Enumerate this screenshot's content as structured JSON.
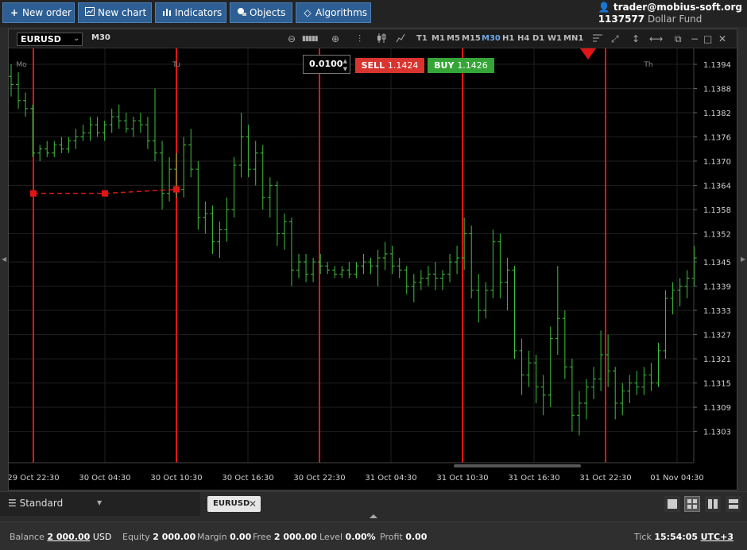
{
  "toolbar": {
    "new_order": "New order",
    "new_chart": "New chart",
    "indicators": "Indicators",
    "objects": "Objects",
    "algorithms": "Algorithms"
  },
  "account": {
    "user": "trader@mobius-soft.org",
    "number": "1137577",
    "fund": "Dollar Fund"
  },
  "chart_header": {
    "symbol": "EURUSD",
    "timeframe": "M30",
    "timeframes": [
      "T1",
      "M1",
      "M5",
      "M15",
      "M30",
      "H1",
      "H4",
      "D1",
      "W1",
      "MN1"
    ],
    "active_timeframe": "M30"
  },
  "order": {
    "quantity": "0.0100",
    "sell_label": "SELL",
    "sell_price": "1.1424",
    "buy_label": "BUY",
    "buy_price": "1.1426"
  },
  "colors": {
    "candle": "#3fbf3f",
    "separator": "#e01515",
    "sell": "#d9342f",
    "buy": "#36a537",
    "accent": "#2d5f94"
  },
  "chart_data": {
    "type": "ohlc",
    "symbol": "EURUSD",
    "timeframe": "M30",
    "day_labels": [
      "Mo",
      "Tu",
      "Th"
    ],
    "x_labels": [
      "29 Oct 22:30",
      "30 Oct 04:30",
      "30 Oct 10:30",
      "30 Oct 16:30",
      "30 Oct 22:30",
      "31 Oct 04:30",
      "31 Oct 10:30",
      "31 Oct 16:30",
      "31 Oct 22:30",
      "01 Nov 04:30"
    ],
    "y_ticks": [
      "1.1394",
      "1.1388",
      "1.1382",
      "1.1376",
      "1.1370",
      "1.1364",
      "1.1358",
      "1.1352",
      "1.1345",
      "1.1339",
      "1.1333",
      "1.1327",
      "1.1321",
      "1.1315",
      "1.1309",
      "1.1303"
    ],
    "ylim": [
      1.1297,
      1.14
    ],
    "separators_at": [
      "29 Oct 22:30",
      "30 Oct 10:30",
      "30 Oct 22:30",
      "31 Oct 10:30",
      "31 Oct 22:30"
    ],
    "trendline": {
      "from": [
        "29 Oct 22:30",
        1.1362
      ],
      "mid": [
        "30 Oct 04:30",
        1.1362
      ],
      "to": [
        "30 Oct 10:30",
        1.1363
      ]
    },
    "series": [
      {
        "values": [
          [
            1.1391,
            1.1394,
            1.1386,
            1.1389
          ],
          [
            1.1389,
            1.1392,
            1.1383,
            1.1385
          ],
          [
            1.1385,
            1.1387,
            1.1381,
            1.1383
          ],
          [
            1.1383,
            1.1384,
            1.1371,
            1.1372
          ],
          [
            1.1372,
            1.1374,
            1.137,
            1.1373
          ],
          [
            1.1373,
            1.1375,
            1.1371,
            1.1372
          ],
          [
            1.1372,
            1.1375,
            1.1371,
            1.1374
          ],
          [
            1.1374,
            1.1376,
            1.1372,
            1.1373
          ],
          [
            1.1373,
            1.1376,
            1.1372,
            1.1375
          ],
          [
            1.1375,
            1.1378,
            1.1373,
            1.1376
          ],
          [
            1.1376,
            1.1379,
            1.1375,
            1.1377
          ],
          [
            1.1377,
            1.1381,
            1.1375,
            1.1379
          ],
          [
            1.1379,
            1.1381,
            1.1376,
            1.1377
          ],
          [
            1.1377,
            1.138,
            1.1375,
            1.1379
          ],
          [
            1.1379,
            1.1383,
            1.1377,
            1.1381
          ],
          [
            1.1381,
            1.1384,
            1.1378,
            1.138
          ],
          [
            1.138,
            1.1382,
            1.1377,
            1.1378
          ],
          [
            1.1378,
            1.1381,
            1.1376,
            1.138
          ],
          [
            1.138,
            1.1382,
            1.1377,
            1.1379
          ],
          [
            1.1379,
            1.1381,
            1.1373,
            1.1375
          ],
          [
            1.1375,
            1.1388,
            1.137,
            1.1372
          ],
          [
            1.1372,
            1.1375,
            1.1358,
            1.1362
          ],
          [
            1.1362,
            1.1371,
            1.136,
            1.1368
          ],
          [
            1.1368,
            1.1372,
            1.1361,
            1.1363
          ],
          [
            1.1363,
            1.1376,
            1.1361,
            1.1374
          ],
          [
            1.1374,
            1.1378,
            1.1366,
            1.1368
          ],
          [
            1.1368,
            1.137,
            1.1353,
            1.1356
          ],
          [
            1.1356,
            1.136,
            1.1352,
            1.1357
          ],
          [
            1.1357,
            1.1359,
            1.1347,
            1.135
          ],
          [
            1.135,
            1.1355,
            1.1346,
            1.1353
          ],
          [
            1.1353,
            1.1361,
            1.135,
            1.1358
          ],
          [
            1.1358,
            1.1371,
            1.1356,
            1.1369
          ],
          [
            1.1369,
            1.1382,
            1.1366,
            1.1376
          ],
          [
            1.1376,
            1.1379,
            1.1366,
            1.1368
          ],
          [
            1.1368,
            1.1375,
            1.1364,
            1.1372
          ],
          [
            1.1372,
            1.1374,
            1.1358,
            1.1361
          ],
          [
            1.1361,
            1.1366,
            1.1356,
            1.1364
          ],
          [
            1.1364,
            1.1365,
            1.1349,
            1.1352
          ],
          [
            1.1352,
            1.1357,
            1.1348,
            1.1355
          ],
          [
            1.1355,
            1.1356,
            1.1339,
            1.1343
          ],
          [
            1.1343,
            1.1347,
            1.1341,
            1.1345
          ],
          [
            1.1345,
            1.1347,
            1.134,
            1.1342
          ],
          [
            1.1342,
            1.1346,
            1.134,
            1.1345
          ],
          [
            1.1345,
            1.1347,
            1.1342,
            1.1344
          ],
          [
            1.1344,
            1.1345,
            1.1342,
            1.1343
          ],
          [
            1.1343,
            1.1344,
            1.1341,
            1.1342
          ],
          [
            1.1342,
            1.1344,
            1.1341,
            1.1343
          ],
          [
            1.1343,
            1.1345,
            1.1341,
            1.1342
          ],
          [
            1.1342,
            1.1345,
            1.1341,
            1.1344
          ],
          [
            1.1344,
            1.1347,
            1.1342,
            1.1345
          ],
          [
            1.1345,
            1.1346,
            1.1342,
            1.1344
          ],
          [
            1.1344,
            1.1348,
            1.1339,
            1.1346
          ],
          [
            1.1346,
            1.135,
            1.1343,
            1.1347
          ],
          [
            1.1347,
            1.1349,
            1.1342,
            1.1344
          ],
          [
            1.1344,
            1.1346,
            1.1341,
            1.1343
          ],
          [
            1.1343,
            1.1344,
            1.1337,
            1.1339
          ],
          [
            1.1339,
            1.1342,
            1.1335,
            1.134
          ],
          [
            1.134,
            1.1343,
            1.1338,
            1.1341
          ],
          [
            1.1341,
            1.1344,
            1.1339,
            1.1342
          ],
          [
            1.1342,
            1.1345,
            1.1338,
            1.1341
          ],
          [
            1.1341,
            1.1343,
            1.1338,
            1.1342
          ],
          [
            1.1342,
            1.1347,
            1.134,
            1.1345
          ],
          [
            1.1345,
            1.1349,
            1.1342,
            1.1346
          ],
          [
            1.1346,
            1.1356,
            1.1343,
            1.1352
          ],
          [
            1.1352,
            1.1354,
            1.1336,
            1.1338
          ],
          [
            1.1338,
            1.1342,
            1.133,
            1.1333
          ],
          [
            1.1333,
            1.134,
            1.1331,
            1.1338
          ],
          [
            1.1338,
            1.1353,
            1.1336,
            1.135
          ],
          [
            1.135,
            1.1352,
            1.1336,
            1.134
          ],
          [
            1.134,
            1.1346,
            1.1333,
            1.1343
          ],
          [
            1.1343,
            1.1344,
            1.1321,
            1.1323
          ],
          [
            1.1323,
            1.1326,
            1.1312,
            1.1317
          ],
          [
            1.1317,
            1.1323,
            1.1314,
            1.132
          ],
          [
            1.132,
            1.1322,
            1.131,
            1.1314
          ],
          [
            1.1314,
            1.1317,
            1.1307,
            1.1312
          ],
          [
            1.1312,
            1.1329,
            1.1309,
            1.1326
          ],
          [
            1.1326,
            1.1344,
            1.1322,
            1.1331
          ],
          [
            1.1331,
            1.1333,
            1.1316,
            1.1319
          ],
          [
            1.1319,
            1.1321,
            1.1303,
            1.1307
          ],
          [
            1.1307,
            1.1313,
            1.1302,
            1.131
          ],
          [
            1.131,
            1.1316,
            1.1306,
            1.1314
          ],
          [
            1.1314,
            1.1319,
            1.1311,
            1.1316
          ],
          [
            1.1316,
            1.1328,
            1.1313,
            1.1322
          ],
          [
            1.1322,
            1.1327,
            1.1314,
            1.1318
          ],
          [
            1.1318,
            1.1319,
            1.1306,
            1.131
          ],
          [
            1.131,
            1.1315,
            1.1307,
            1.1313
          ],
          [
            1.1313,
            1.1317,
            1.131,
            1.1315
          ],
          [
            1.1315,
            1.1318,
            1.1312,
            1.1314
          ],
          [
            1.1314,
            1.1319,
            1.1312,
            1.1317
          ],
          [
            1.1317,
            1.132,
            1.1313,
            1.1315
          ],
          [
            1.1315,
            1.1325,
            1.1314,
            1.1323
          ],
          [
            1.1323,
            1.1338,
            1.1321,
            1.1336
          ],
          [
            1.1336,
            1.134,
            1.1332,
            1.1338
          ],
          [
            1.1338,
            1.1341,
            1.1334,
            1.1339
          ],
          [
            1.1339,
            1.1343,
            1.1336,
            1.1341
          ],
          [
            1.1341,
            1.1349,
            1.1339,
            1.1346
          ]
        ]
      }
    ]
  },
  "footer": {
    "layout_name": "Standard",
    "tab_symbol": "EURUSD"
  },
  "status": {
    "balance_label": "Balance",
    "balance_value": "2 000.00",
    "balance_ccy": "USD",
    "equity_label": "Equity",
    "equity_value": "2 000.00",
    "margin_label": "Margin",
    "margin_value": "0.00",
    "free_label": "Free",
    "free_value": "2 000.00",
    "level_label": "Level",
    "level_value": "0.00%",
    "profit_label": "Profit",
    "profit_value": "0.00",
    "tick_label": "Tick",
    "tick_time": "15:54:05",
    "timezone": "UTC+3"
  }
}
